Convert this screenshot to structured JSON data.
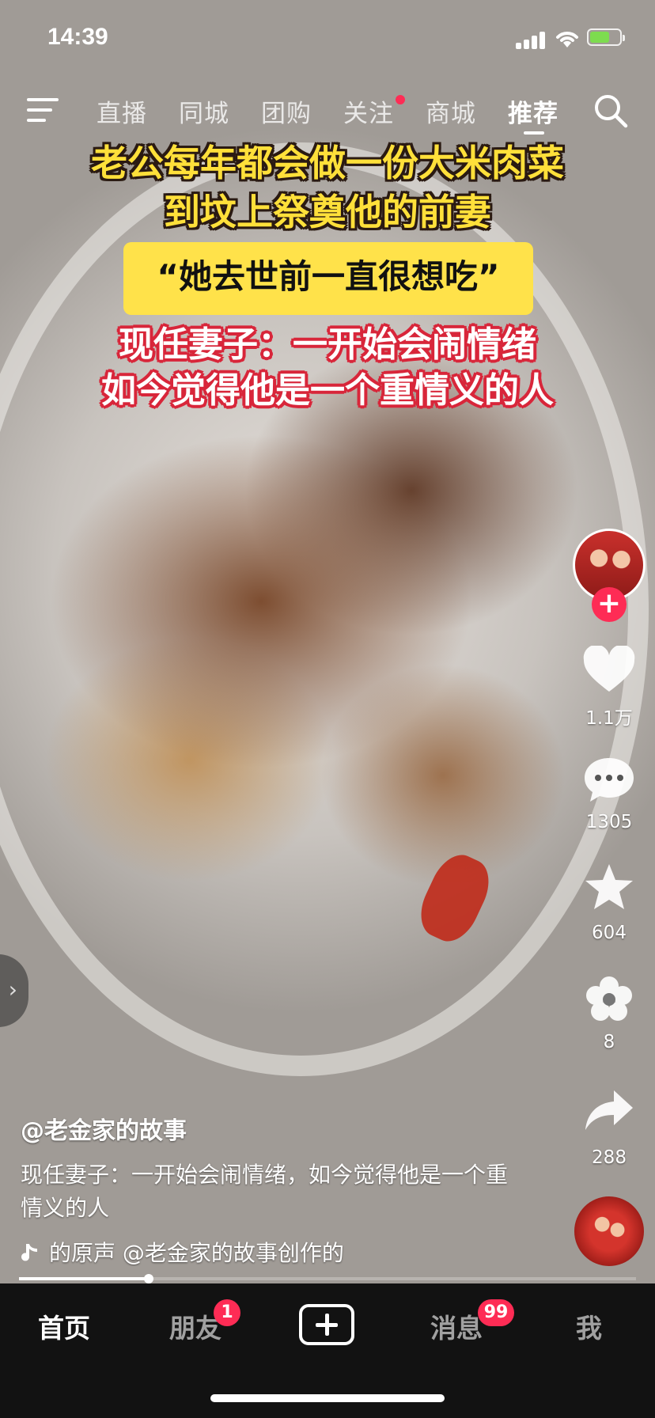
{
  "status_bar": {
    "time": "14:39"
  },
  "top_nav": {
    "tabs": [
      {
        "label": "直播"
      },
      {
        "label": "同城"
      },
      {
        "label": "团购"
      },
      {
        "label": "关注",
        "has_dot": true
      },
      {
        "label": "商城"
      },
      {
        "label": "推荐",
        "active": true
      }
    ]
  },
  "video": {
    "caption_line1": "老公每年都会做一份大米肉菜",
    "caption_line2": "到坟上祭奠他的前妻",
    "quote": "“她去世前一直很想吃”",
    "caption_line3": "现任妻子：一开始会闹情绪",
    "caption_line4": "如今觉得他是一个重情义的人",
    "author": "@老金家的故事",
    "description": "现任妻子：一开始会闹情绪，如今觉得他是一个重情义的人",
    "music": "的原声   @老金家的故事创作的",
    "progress_fraction": 0.21
  },
  "actions": {
    "likes": "1.1万",
    "comments": "1305",
    "favorites": "604",
    "shares_flower": "8",
    "forwards": "288"
  },
  "tab_bar": {
    "home": "首页",
    "friends": "朋友",
    "friends_badge": "1",
    "messages": "消息",
    "messages_badge": "99",
    "me": "我"
  },
  "colors": {
    "accent_red": "#fe2c55",
    "caption_yellow": "#ffe03a",
    "tab_bar_bg": "#121212"
  }
}
